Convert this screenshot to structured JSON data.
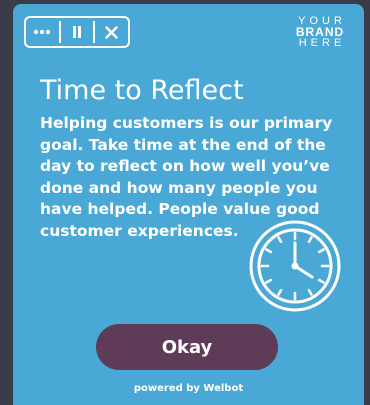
{
  "toolbar": {
    "more_icon": "more-dots-icon",
    "pause_icon": "pause-icon",
    "close_icon": "close-icon"
  },
  "brand": {
    "line1": "YOUR",
    "line2": "BRAND",
    "line3": "HERE"
  },
  "card": {
    "title": "Time to Reflect",
    "body": "Helping customers is our primary goal. Take time at the end of the day to reflect on how well you’ve done and how many people you have helped. People value good customer experiences.",
    "clock_icon": "clock-icon",
    "okay_label": "Okay",
    "powered_by": "powered by Welbot"
  },
  "colors": {
    "card_background": "#4aa8d6",
    "button_background": "#5e3c57",
    "page_background": "#3a3c48",
    "text": "#ffffff"
  }
}
